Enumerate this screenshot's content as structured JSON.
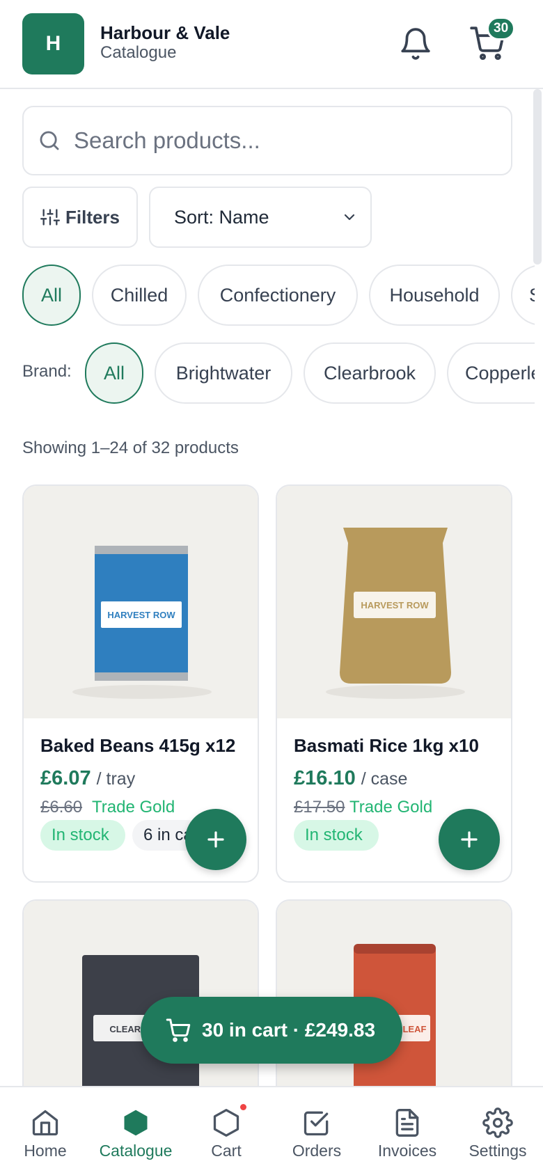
{
  "header": {
    "logo_letter": "H",
    "brand_name": "Harbour & Vale",
    "brand_sub": "Catalogue",
    "cart_count": "30"
  },
  "search": {
    "placeholder": "Search products..."
  },
  "toolbar": {
    "filters_label": "Filters",
    "sort_label": "Sort: Name"
  },
  "categories": [
    "All",
    "Chilled",
    "Confectionery",
    "Household",
    "S"
  ],
  "brands": {
    "label": "Brand:",
    "items": [
      "All",
      "Brightwater",
      "Clearbrook",
      "Copperleaf"
    ]
  },
  "results_text": "Showing 1–24 of 32 products",
  "products": [
    {
      "name": "Baked Beans 415g x12",
      "price": "£6.07",
      "unit": "/ tray",
      "old_price": "£6.60",
      "tier": "Trade Gold",
      "stock": "In stock",
      "qty": "6 in cart",
      "image_label": "HARVEST ROW",
      "image_color": "#2f7fbf"
    },
    {
      "name": "Basmati Rice 1kg x10",
      "price": "£16.10",
      "unit": "/ case",
      "old_price": "£17.50",
      "tier": "Trade Gold",
      "stock": "In stock",
      "image_label": "HARVEST ROW",
      "image_color": "#b89a5c"
    },
    {
      "image_label": "CLEARBROOK",
      "image_color": "#3d4049"
    },
    {
      "image_label": "COPPERLEAF",
      "image_color": "#cf553a"
    }
  ],
  "float_cart": {
    "label": "30 in cart · £249.83"
  },
  "nav": {
    "home": "Home",
    "catalogue": "Catalogue",
    "cart": "Cart",
    "orders": "Orders",
    "invoices": "Invoices",
    "settings": "Settings"
  },
  "colors": {
    "accent": "#1f7a5c",
    "stock_green": "#22b573",
    "badge_red": "#ef4444"
  }
}
